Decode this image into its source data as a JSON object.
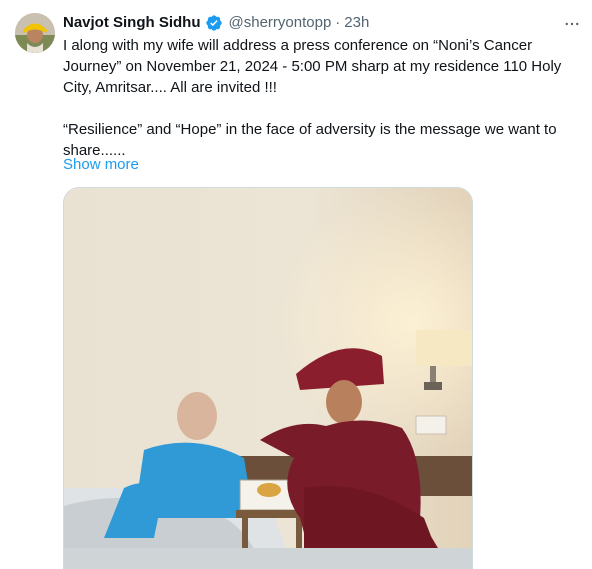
{
  "tweet": {
    "author_name": "Navjot Singh Sidhu",
    "handle": "@sherryontopp",
    "separator": "·",
    "time": "23h",
    "text_line1": "I along with my wife will address a press conference on “Noni’s Cancer Journey” on November 21, 2024 - 5:00 PM sharp at my residence 110 Holy City, Amritsar.... All are invited !!!",
    "text_line2": "“Resilience” and “Hope” in the face of adversity is the message we want to share......",
    "show_more_label": "Show more",
    "media_alt": "photo",
    "colors": {
      "link": "#1d9bf0",
      "secondary_text": "#536471",
      "verified_badge": "#1d9bf0"
    },
    "icons": {
      "verified": "verified-badge-icon",
      "more": "more-options-icon"
    }
  }
}
